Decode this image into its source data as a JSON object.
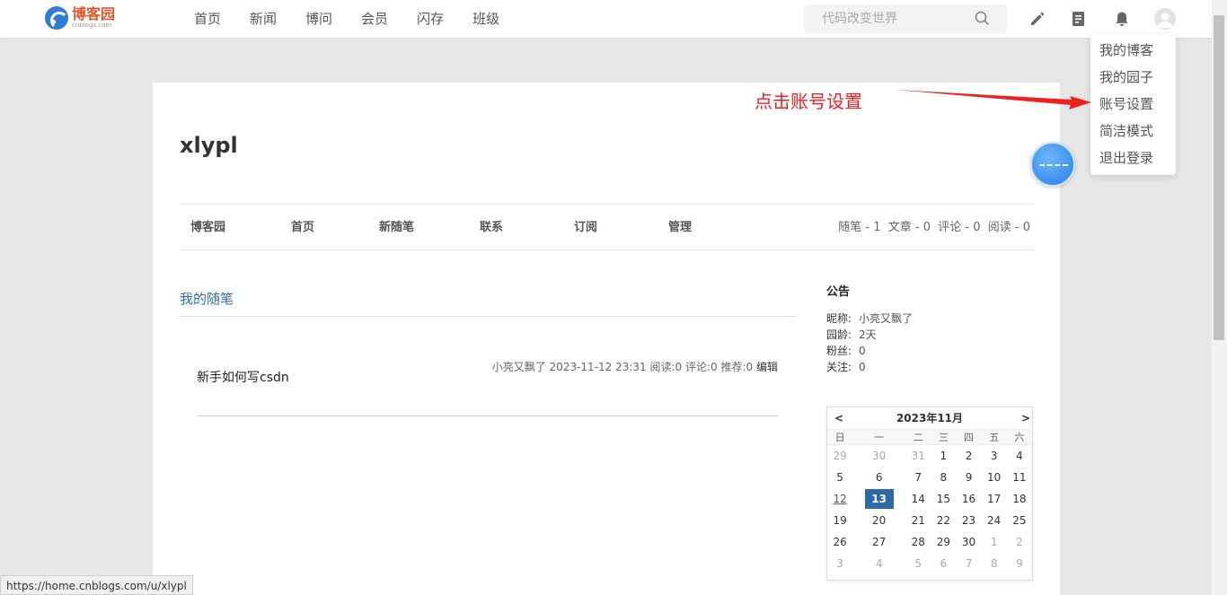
{
  "header": {
    "logo_cn": "博客园",
    "logo_en": "cnblogs.com",
    "nav": [
      "首页",
      "新闻",
      "博问",
      "会员",
      "闪存",
      "班级"
    ],
    "search_placeholder": "代码改变世界"
  },
  "user_menu": {
    "items": [
      "我的博客",
      "我的园子",
      "账号设置",
      "简洁模式",
      "退出登录"
    ]
  },
  "annotation": {
    "text": "点击账号设置",
    "color": "#ee2020"
  },
  "blog": {
    "title": "xlypl",
    "subnav": [
      "博客园",
      "首页",
      "新随笔",
      "联系",
      "订阅",
      "管理"
    ],
    "stats": "随笔 - 1  文章 - 0  评论 - 0  阅读 - 0",
    "section_title": "我的随笔",
    "post": {
      "title": "新手如何写csdn",
      "meta": "小亮又飘了 2023-11-12 23:31 阅读:0 评论:0 推荐:0 ",
      "edit": "编辑"
    }
  },
  "notice": {
    "title": "公告",
    "rows": [
      {
        "label": "昵称:",
        "value": "小亮又飘了"
      },
      {
        "label": "园龄:",
        "value": "2天"
      },
      {
        "label": "粉丝:",
        "value": "0"
      },
      {
        "label": "关注:",
        "value": "0"
      }
    ]
  },
  "calendar": {
    "prev": "<",
    "next": ">",
    "month": "2023年11月",
    "weekdays": [
      "日",
      "一",
      "二",
      "三",
      "四",
      "五",
      "六"
    ],
    "weeks": [
      [
        [
          "29",
          "other"
        ],
        [
          "30",
          "other"
        ],
        [
          "31",
          "other"
        ],
        [
          "1",
          ""
        ],
        [
          "2",
          ""
        ],
        [
          "3",
          ""
        ],
        [
          "4",
          ""
        ]
      ],
      [
        [
          "5",
          ""
        ],
        [
          "6",
          ""
        ],
        [
          "7",
          ""
        ],
        [
          "8",
          ""
        ],
        [
          "9",
          ""
        ],
        [
          "10",
          ""
        ],
        [
          "11",
          ""
        ]
      ],
      [
        [
          "12",
          "link"
        ],
        [
          "13",
          "today"
        ],
        [
          "14",
          ""
        ],
        [
          "15",
          ""
        ],
        [
          "16",
          ""
        ],
        [
          "17",
          ""
        ],
        [
          "18",
          ""
        ]
      ],
      [
        [
          "19",
          ""
        ],
        [
          "20",
          ""
        ],
        [
          "21",
          ""
        ],
        [
          "22",
          ""
        ],
        [
          "23",
          ""
        ],
        [
          "24",
          ""
        ],
        [
          "25",
          ""
        ]
      ],
      [
        [
          "26",
          ""
        ],
        [
          "27",
          ""
        ],
        [
          "28",
          ""
        ],
        [
          "29",
          ""
        ],
        [
          "30",
          ""
        ],
        [
          "1",
          "other"
        ],
        [
          "2",
          "other"
        ]
      ],
      [
        [
          "3",
          "other"
        ],
        [
          "4",
          "other"
        ],
        [
          "5",
          "other"
        ],
        [
          "6",
          "other"
        ],
        [
          "7",
          "other"
        ],
        [
          "8",
          "other"
        ],
        [
          "9",
          "other"
        ]
      ]
    ]
  },
  "status_bar": {
    "url": "https://home.cnblogs.com/u/xlypl"
  },
  "colors": {
    "accent": "#2f6aa8",
    "logo": "#e0582b",
    "link": "#2e6da4"
  },
  "icons": [
    "search-icon",
    "edit-pen-icon",
    "article-icon",
    "bell-icon",
    "avatar-icon",
    "arrow-annotation"
  ]
}
